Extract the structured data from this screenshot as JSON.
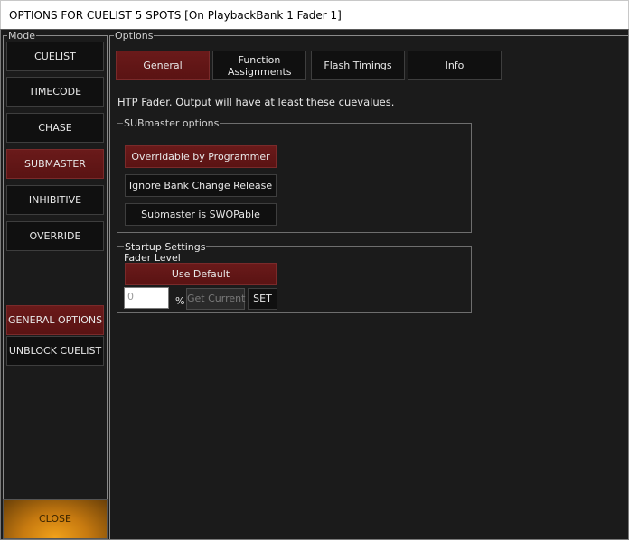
{
  "window": {
    "title": "OPTIONS FOR CUELIST 5 SPOTS  [On PlaybackBank 1 Fader 1]"
  },
  "mode": {
    "group_label": "Mode",
    "buttons": [
      {
        "label": "CUELIST",
        "active": false
      },
      {
        "label": "TIMECODE",
        "active": false
      },
      {
        "label": "CHASE",
        "active": false
      },
      {
        "label": "SUBMASTER",
        "active": true
      },
      {
        "label": "INHIBITIVE",
        "active": false
      },
      {
        "label": "OVERRIDE",
        "active": false
      }
    ],
    "general_options": "GENERAL OPTIONS",
    "unblock_cuelist": "UNBLOCK CUELIST",
    "close": "CLOSE"
  },
  "options": {
    "group_label": "Options",
    "tabs": [
      {
        "label": "General",
        "active": true
      },
      {
        "label": "Function Assignments",
        "active": false
      },
      {
        "label": "Flash Timings",
        "active": false
      },
      {
        "label": "Info",
        "active": false
      }
    ],
    "info_text": "HTP Fader. Output will have at least these cuevalues.",
    "submaster": {
      "group_label": "SUBmaster options",
      "overridable": "Overridable by Programmer",
      "ignore_bank": "Ignore Bank Change Release",
      "swopable": "Submaster is SWOPable"
    },
    "startup": {
      "group_label": "Startup Settings",
      "fader_level_label": "Fader Level",
      "use_default": "Use Default",
      "level_value": "0",
      "percent": "%",
      "get_current": "Get Current",
      "set": "SET"
    }
  },
  "colors": {
    "background": "#1b1b1b",
    "active_button": "#5e1616",
    "close_accent": "#f2a21a"
  }
}
